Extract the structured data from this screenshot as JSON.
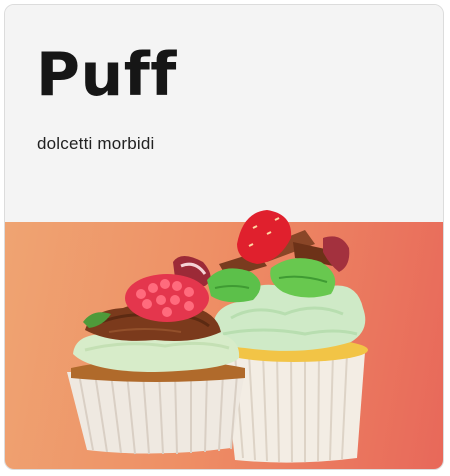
{
  "card": {
    "title": "Puff",
    "subtitle": "dolcetti morbidi",
    "image": {
      "subject": "cupcakes",
      "colors": {
        "background_start": "#efa472",
        "background_end": "#e8685a",
        "header_background": "#f4f4f4",
        "title_color": "#161616"
      }
    }
  }
}
